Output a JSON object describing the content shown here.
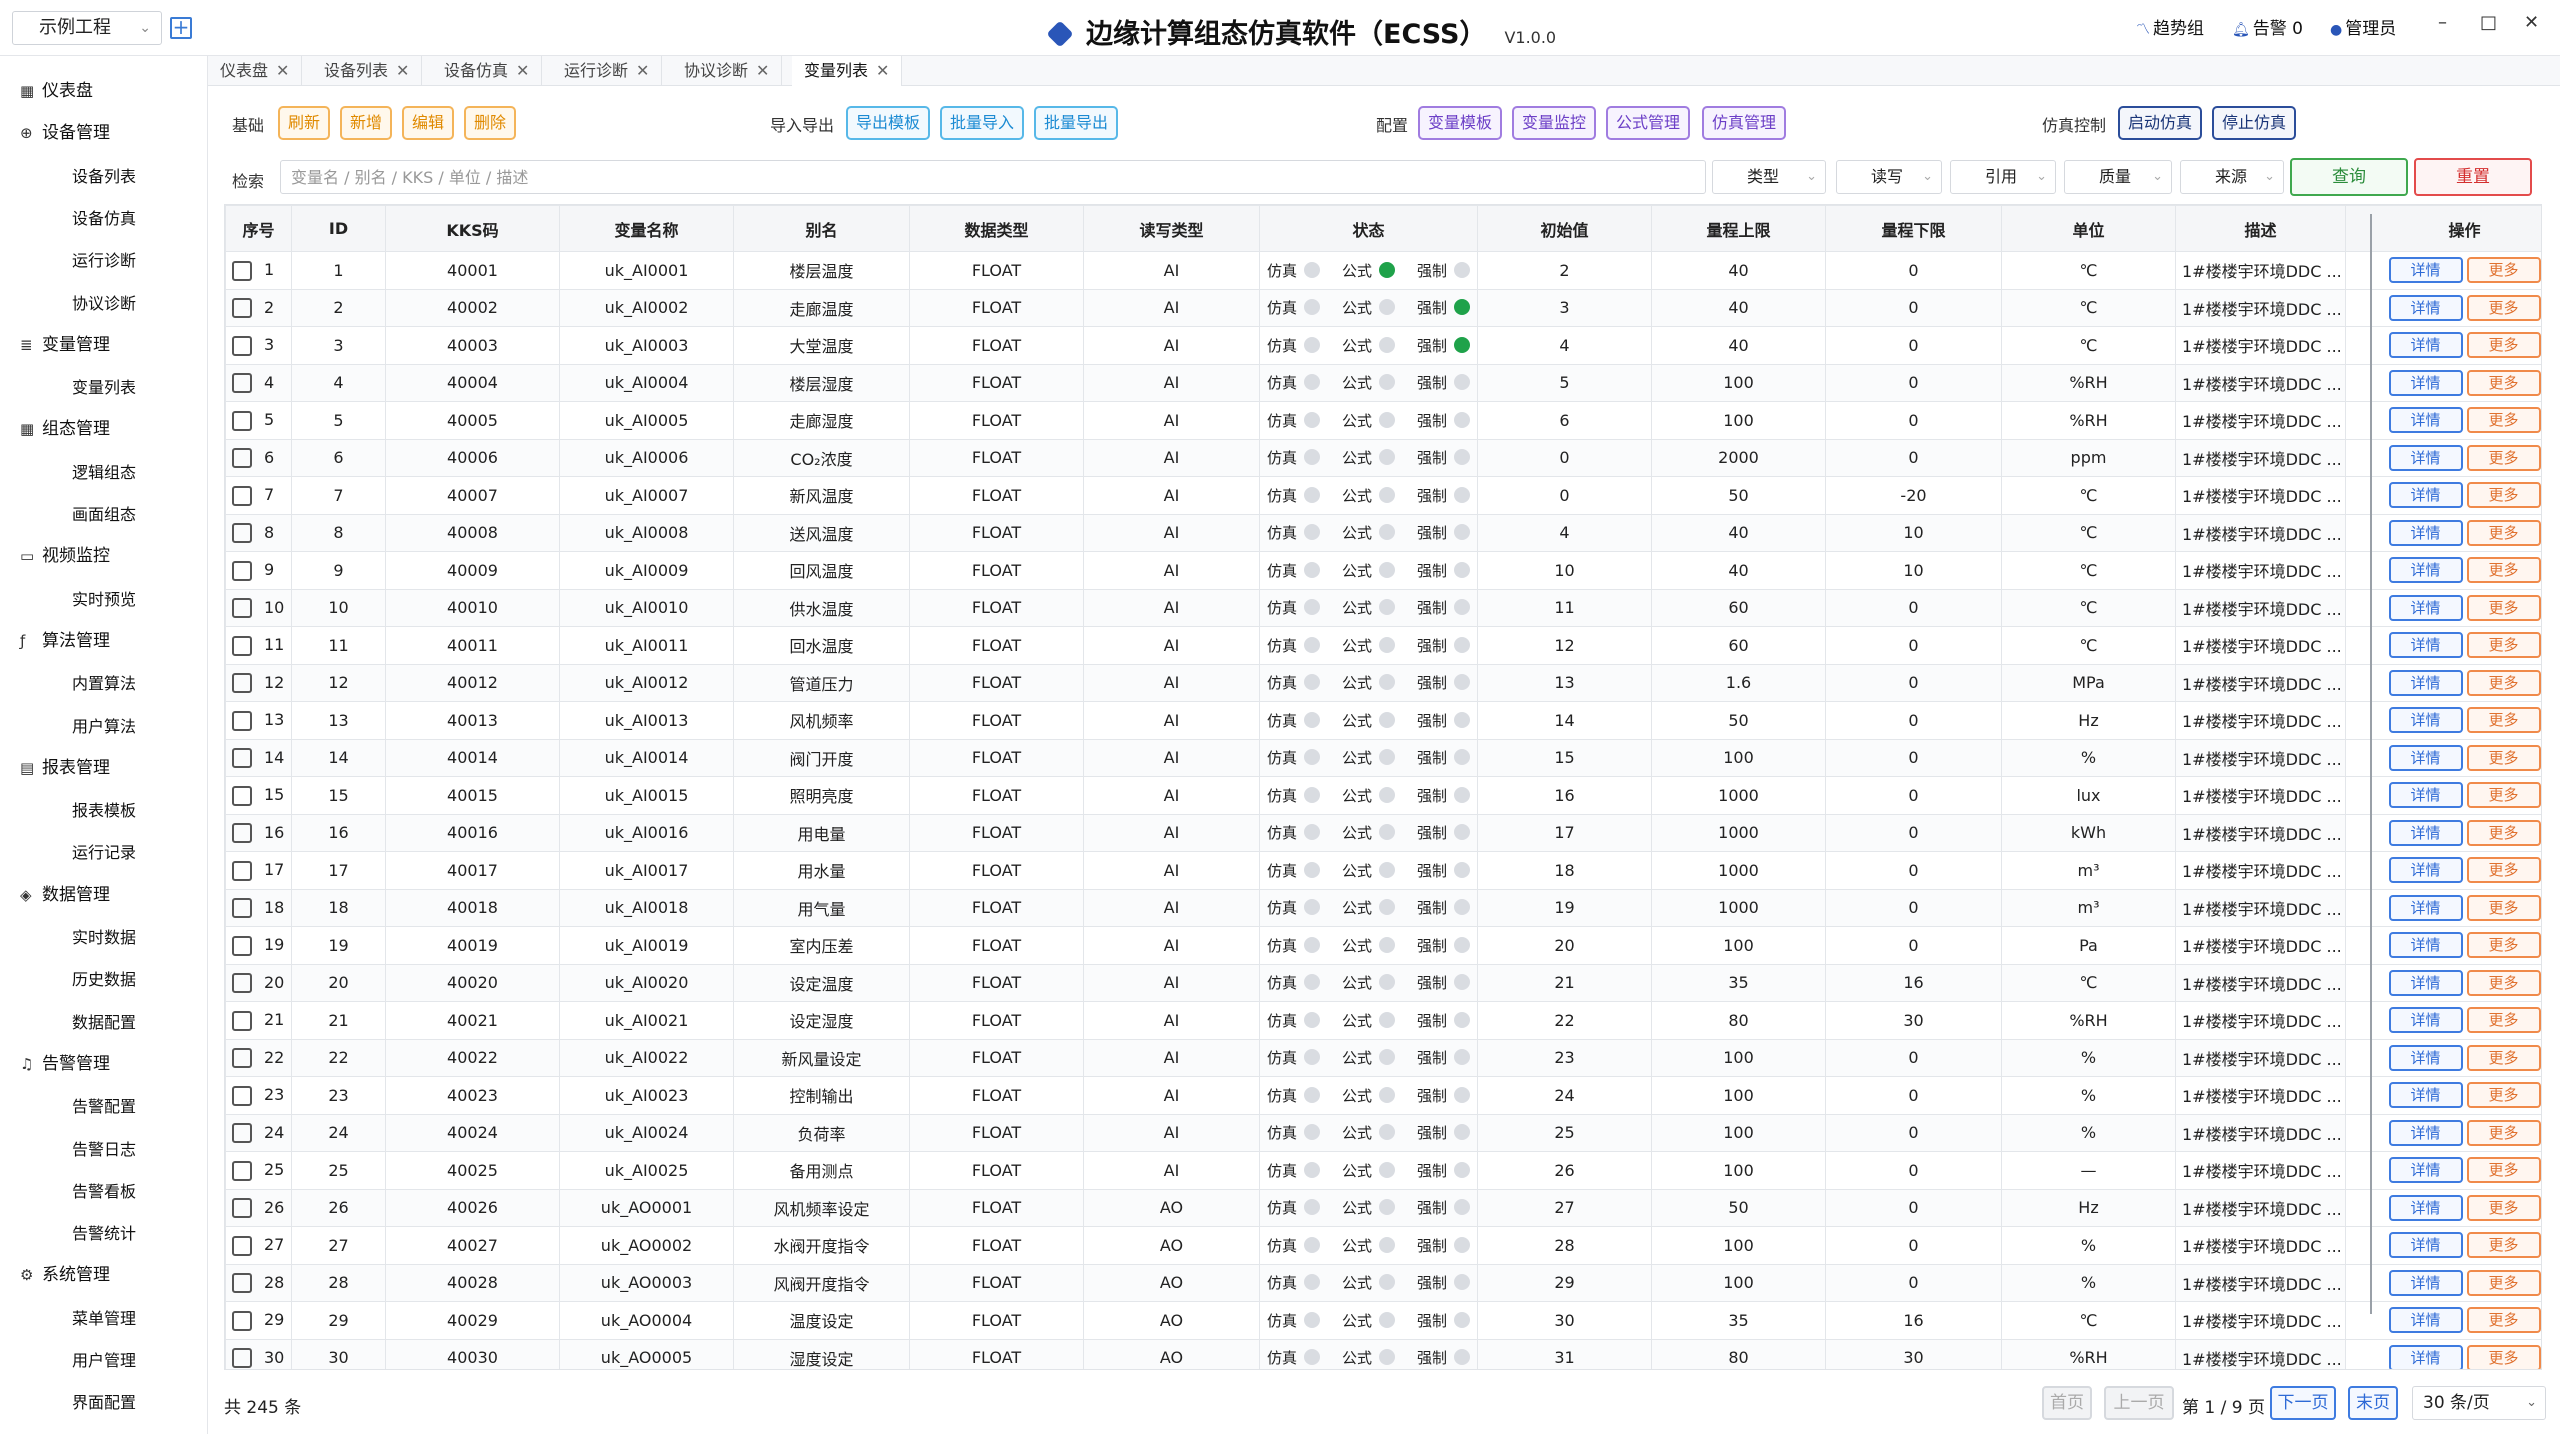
{
  "titlebar": {
    "project": "示例工程",
    "title": "边缘计算组态仿真软件（ECSS）",
    "version": "V1.0.0",
    "trend": "趋势组",
    "alarm": "告警 0",
    "user": "管理员"
  },
  "sidebar": {
    "groups": [
      {
        "label": "仪表盘",
        "icon": "dashboard-icon",
        "items": []
      },
      {
        "label": "设备管理",
        "icon": "device-icon",
        "items": [
          "设备列表",
          "设备仿真",
          "运行诊断",
          "协议诊断"
        ]
      },
      {
        "label": "变量管理",
        "icon": "database-icon",
        "items": [
          "变量列表"
        ]
      },
      {
        "label": "组态管理",
        "icon": "grid-icon",
        "items": [
          "逻辑组态",
          "画面组态"
        ]
      },
      {
        "label": "视频监控",
        "icon": "folder-icon",
        "items": [
          "实时预览"
        ]
      },
      {
        "label": "算法管理",
        "icon": "function-icon",
        "items": [
          "内置算法",
          "用户算法"
        ]
      },
      {
        "label": "报表管理",
        "icon": "report-icon",
        "items": [
          "报表模板",
          "运行记录"
        ]
      },
      {
        "label": "数据管理",
        "icon": "layers-icon",
        "items": [
          "实时数据",
          "历史数据",
          "数据配置"
        ]
      },
      {
        "label": "告警管理",
        "icon": "bell-icon",
        "items": [
          "告警配置",
          "告警日志",
          "告警看板",
          "告警统计"
        ]
      },
      {
        "label": "系统管理",
        "icon": "settings-icon",
        "items": [
          "菜单管理",
          "用户管理",
          "界面配置"
        ]
      }
    ]
  },
  "tabs": [
    "仪表盘",
    "设备列表",
    "设备仿真",
    "运行诊断",
    "协议诊断",
    "变量列表"
  ],
  "active_tab": "变量列表",
  "toolbar": {
    "basic_label": "基础",
    "basic": [
      "刷新",
      "新增",
      "编辑",
      "删除"
    ],
    "io_label": "导入导出",
    "io": [
      "导出模板",
      "批量导入",
      "批量导出"
    ],
    "config_label": "配置",
    "config": [
      "变量模板",
      "变量监控",
      "公式管理",
      "仿真管理"
    ],
    "sim_label": "仿真控制",
    "sim": [
      "启动仿真",
      "停止仿真"
    ]
  },
  "search": {
    "label": "检索",
    "placeholder": "变量名 / 别名 / KKS / 单位 / 描述",
    "filters": [
      "类型",
      "读写",
      "引用",
      "质量",
      "来源"
    ],
    "query": "查询",
    "reset": "重置"
  },
  "table": {
    "columns": [
      "序号",
      "ID",
      "KKS码",
      "变量名称",
      "别名",
      "数据类型",
      "读写类型",
      "状态",
      "初始值",
      "量程上限",
      "量程下限",
      "单位",
      "描述",
      "操作"
    ],
    "status_labels": [
      "仿真",
      "公式",
      "强制"
    ],
    "op_labels": [
      "详情",
      "更多"
    ],
    "rows": [
      {
        "no": "1",
        "id": "1",
        "kks": "40001",
        "name": "uk_AI0001",
        "alias": "楼层温度",
        "dtype": "FLOAT",
        "rw": "AI",
        "sim": false,
        "formula": true,
        "force": false,
        "init": "2",
        "max": "40",
        "min": "0",
        "unit": "℃",
        "desc": "1#楼楼宇环境DDC ..."
      },
      {
        "no": "2",
        "id": "2",
        "kks": "40002",
        "name": "uk_AI0002",
        "alias": "走廊温度",
        "dtype": "FLOAT",
        "rw": "AI",
        "sim": false,
        "formula": false,
        "force": true,
        "init": "3",
        "max": "40",
        "min": "0",
        "unit": "℃",
        "desc": "1#楼楼宇环境DDC ..."
      },
      {
        "no": "3",
        "id": "3",
        "kks": "40003",
        "name": "uk_AI0003",
        "alias": "大堂温度",
        "dtype": "FLOAT",
        "rw": "AI",
        "sim": false,
        "formula": false,
        "force": true,
        "init": "4",
        "max": "40",
        "min": "0",
        "unit": "℃",
        "desc": "1#楼楼宇环境DDC ..."
      },
      {
        "no": "4",
        "id": "4",
        "kks": "40004",
        "name": "uk_AI0004",
        "alias": "楼层湿度",
        "dtype": "FLOAT",
        "rw": "AI",
        "sim": false,
        "formula": false,
        "force": false,
        "init": "5",
        "max": "100",
        "min": "0",
        "unit": "%RH",
        "desc": "1#楼楼宇环境DDC ..."
      },
      {
        "no": "5",
        "id": "5",
        "kks": "40005",
        "name": "uk_AI0005",
        "alias": "走廊湿度",
        "dtype": "FLOAT",
        "rw": "AI",
        "sim": false,
        "formula": false,
        "force": false,
        "init": "6",
        "max": "100",
        "min": "0",
        "unit": "%RH",
        "desc": "1#楼楼宇环境DDC ..."
      },
      {
        "no": "6",
        "id": "6",
        "kks": "40006",
        "name": "uk_AI0006",
        "alias": "CO₂浓度",
        "dtype": "FLOAT",
        "rw": "AI",
        "sim": false,
        "formula": false,
        "force": false,
        "init": "0",
        "max": "2000",
        "min": "0",
        "unit": "ppm",
        "desc": "1#楼楼宇环境DDC ..."
      },
      {
        "no": "7",
        "id": "7",
        "kks": "40007",
        "name": "uk_AI0007",
        "alias": "新风温度",
        "dtype": "FLOAT",
        "rw": "AI",
        "sim": false,
        "formula": false,
        "force": false,
        "init": "0",
        "max": "50",
        "min": "-20",
        "unit": "℃",
        "desc": "1#楼楼宇环境DDC ..."
      },
      {
        "no": "8",
        "id": "8",
        "kks": "40008",
        "name": "uk_AI0008",
        "alias": "送风温度",
        "dtype": "FLOAT",
        "rw": "AI",
        "sim": false,
        "formula": false,
        "force": false,
        "init": "4",
        "max": "40",
        "min": "10",
        "unit": "℃",
        "desc": "1#楼楼宇环境DDC ..."
      },
      {
        "no": "9",
        "id": "9",
        "kks": "40009",
        "name": "uk_AI0009",
        "alias": "回风温度",
        "dtype": "FLOAT",
        "rw": "AI",
        "sim": false,
        "formula": false,
        "force": false,
        "init": "10",
        "max": "40",
        "min": "10",
        "unit": "℃",
        "desc": "1#楼楼宇环境DDC ..."
      },
      {
        "no": "10",
        "id": "10",
        "kks": "40010",
        "name": "uk_AI0010",
        "alias": "供水温度",
        "dtype": "FLOAT",
        "rw": "AI",
        "sim": false,
        "formula": false,
        "force": false,
        "init": "11",
        "max": "60",
        "min": "0",
        "unit": "℃",
        "desc": "1#楼楼宇环境DDC ..."
      },
      {
        "no": "11",
        "id": "11",
        "kks": "40011",
        "name": "uk_AI0011",
        "alias": "回水温度",
        "dtype": "FLOAT",
        "rw": "AI",
        "sim": false,
        "formula": false,
        "force": false,
        "init": "12",
        "max": "60",
        "min": "0",
        "unit": "℃",
        "desc": "1#楼楼宇环境DDC ..."
      },
      {
        "no": "12",
        "id": "12",
        "kks": "40012",
        "name": "uk_AI0012",
        "alias": "管道压力",
        "dtype": "FLOAT",
        "rw": "AI",
        "sim": false,
        "formula": false,
        "force": false,
        "init": "13",
        "max": "1.6",
        "min": "0",
        "unit": "MPa",
        "desc": "1#楼楼宇环境DDC ..."
      },
      {
        "no": "13",
        "id": "13",
        "kks": "40013",
        "name": "uk_AI0013",
        "alias": "风机频率",
        "dtype": "FLOAT",
        "rw": "AI",
        "sim": false,
        "formula": false,
        "force": false,
        "init": "14",
        "max": "50",
        "min": "0",
        "unit": "Hz",
        "desc": "1#楼楼宇环境DDC ..."
      },
      {
        "no": "14",
        "id": "14",
        "kks": "40014",
        "name": "uk_AI0014",
        "alias": "阀门开度",
        "dtype": "FLOAT",
        "rw": "AI",
        "sim": false,
        "formula": false,
        "force": false,
        "init": "15",
        "max": "100",
        "min": "0",
        "unit": "%",
        "desc": "1#楼楼宇环境DDC ..."
      },
      {
        "no": "15",
        "id": "15",
        "kks": "40015",
        "name": "uk_AI0015",
        "alias": "照明亮度",
        "dtype": "FLOAT",
        "rw": "AI",
        "sim": false,
        "formula": false,
        "force": false,
        "init": "16",
        "max": "1000",
        "min": "0",
        "unit": "lux",
        "desc": "1#楼楼宇环境DDC ..."
      },
      {
        "no": "16",
        "id": "16",
        "kks": "40016",
        "name": "uk_AI0016",
        "alias": "用电量",
        "dtype": "FLOAT",
        "rw": "AI",
        "sim": false,
        "formula": false,
        "force": false,
        "init": "17",
        "max": "1000",
        "min": "0",
        "unit": "kWh",
        "desc": "1#楼楼宇环境DDC ..."
      },
      {
        "no": "17",
        "id": "17",
        "kks": "40017",
        "name": "uk_AI0017",
        "alias": "用水量",
        "dtype": "FLOAT",
        "rw": "AI",
        "sim": false,
        "formula": false,
        "force": false,
        "init": "18",
        "max": "1000",
        "min": "0",
        "unit": "m³",
        "desc": "1#楼楼宇环境DDC ..."
      },
      {
        "no": "18",
        "id": "18",
        "kks": "40018",
        "name": "uk_AI0018",
        "alias": "用气量",
        "dtype": "FLOAT",
        "rw": "AI",
        "sim": false,
        "formula": false,
        "force": false,
        "init": "19",
        "max": "1000",
        "min": "0",
        "unit": "m³",
        "desc": "1#楼楼宇环境DDC ..."
      },
      {
        "no": "19",
        "id": "19",
        "kks": "40019",
        "name": "uk_AI0019",
        "alias": "室内压差",
        "dtype": "FLOAT",
        "rw": "AI",
        "sim": false,
        "formula": false,
        "force": false,
        "init": "20",
        "max": "100",
        "min": "0",
        "unit": "Pa",
        "desc": "1#楼楼宇环境DDC ..."
      },
      {
        "no": "20",
        "id": "20",
        "kks": "40020",
        "name": "uk_AI0020",
        "alias": "设定温度",
        "dtype": "FLOAT",
        "rw": "AI",
        "sim": false,
        "formula": false,
        "force": false,
        "init": "21",
        "max": "35",
        "min": "16",
        "unit": "℃",
        "desc": "1#楼楼宇环境DDC ..."
      },
      {
        "no": "21",
        "id": "21",
        "kks": "40021",
        "name": "uk_AI0021",
        "alias": "设定湿度",
        "dtype": "FLOAT",
        "rw": "AI",
        "sim": false,
        "formula": false,
        "force": false,
        "init": "22",
        "max": "80",
        "min": "30",
        "unit": "%RH",
        "desc": "1#楼楼宇环境DDC ..."
      },
      {
        "no": "22",
        "id": "22",
        "kks": "40022",
        "name": "uk_AI0022",
        "alias": "新风量设定",
        "dtype": "FLOAT",
        "rw": "AI",
        "sim": false,
        "formula": false,
        "force": false,
        "init": "23",
        "max": "100",
        "min": "0",
        "unit": "%",
        "desc": "1#楼楼宇环境DDC ..."
      },
      {
        "no": "23",
        "id": "23",
        "kks": "40023",
        "name": "uk_AI0023",
        "alias": "控制输出",
        "dtype": "FLOAT",
        "rw": "AI",
        "sim": false,
        "formula": false,
        "force": false,
        "init": "24",
        "max": "100",
        "min": "0",
        "unit": "%",
        "desc": "1#楼楼宇环境DDC ..."
      },
      {
        "no": "24",
        "id": "24",
        "kks": "40024",
        "name": "uk_AI0024",
        "alias": "负荷率",
        "dtype": "FLOAT",
        "rw": "AI",
        "sim": false,
        "formula": false,
        "force": false,
        "init": "25",
        "max": "100",
        "min": "0",
        "unit": "%",
        "desc": "1#楼楼宇环境DDC ..."
      },
      {
        "no": "25",
        "id": "25",
        "kks": "40025",
        "name": "uk_AI0025",
        "alias": "备用测点",
        "dtype": "FLOAT",
        "rw": "AI",
        "sim": false,
        "formula": false,
        "force": false,
        "init": "26",
        "max": "100",
        "min": "0",
        "unit": "—",
        "desc": "1#楼楼宇环境DDC ..."
      },
      {
        "no": "26",
        "id": "26",
        "kks": "40026",
        "name": "uk_AO0001",
        "alias": "风机频率设定",
        "dtype": "FLOAT",
        "rw": "AO",
        "sim": false,
        "formula": false,
        "force": false,
        "init": "27",
        "max": "50",
        "min": "0",
        "unit": "Hz",
        "desc": "1#楼楼宇环境DDC ..."
      },
      {
        "no": "27",
        "id": "27",
        "kks": "40027",
        "name": "uk_AO0002",
        "alias": "水阀开度指令",
        "dtype": "FLOAT",
        "rw": "AO",
        "sim": false,
        "formula": false,
        "force": false,
        "init": "28",
        "max": "100",
        "min": "0",
        "unit": "%",
        "desc": "1#楼楼宇环境DDC ..."
      },
      {
        "no": "28",
        "id": "28",
        "kks": "40028",
        "name": "uk_AO0003",
        "alias": "风阀开度指令",
        "dtype": "FLOAT",
        "rw": "AO",
        "sim": false,
        "formula": false,
        "force": false,
        "init": "29",
        "max": "100",
        "min": "0",
        "unit": "%",
        "desc": "1#楼楼宇环境DDC ..."
      },
      {
        "no": "29",
        "id": "29",
        "kks": "40029",
        "name": "uk_AO0004",
        "alias": "温度设定",
        "dtype": "FLOAT",
        "rw": "AO",
        "sim": false,
        "formula": false,
        "force": false,
        "init": "30",
        "max": "35",
        "min": "16",
        "unit": "℃",
        "desc": "1#楼楼宇环境DDC ..."
      },
      {
        "no": "30",
        "id": "30",
        "kks": "40030",
        "name": "uk_AO0005",
        "alias": "湿度设定",
        "dtype": "FLOAT",
        "rw": "AO",
        "sim": false,
        "formula": false,
        "force": false,
        "init": "31",
        "max": "80",
        "min": "30",
        "unit": "%RH",
        "desc": "1#楼楼宇环境DDC ..."
      }
    ]
  },
  "footer": {
    "total": "共 245 条",
    "first": "首页",
    "prev": "上一页",
    "page_info": "第 1 / 9 页",
    "next": "下一页",
    "last": "末页",
    "per_page": "30 条/页"
  }
}
